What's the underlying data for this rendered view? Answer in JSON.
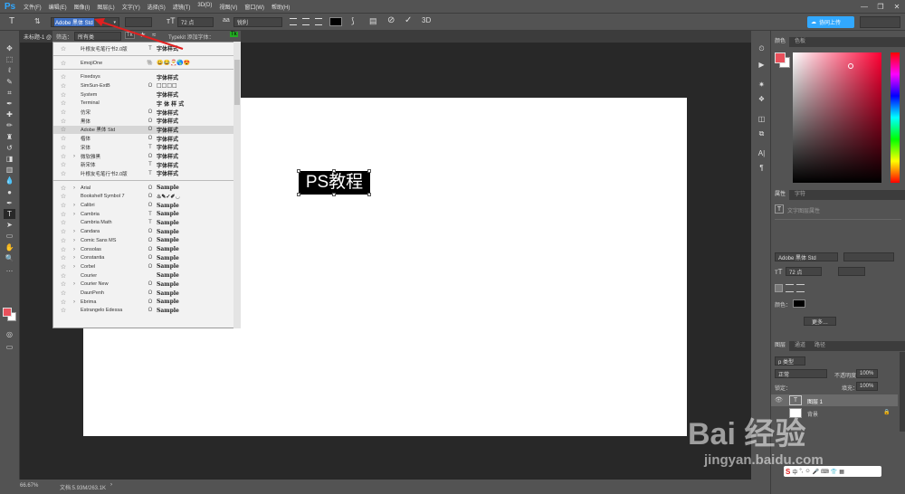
{
  "app": {
    "logo": "Ps",
    "share_button": "协同上传"
  },
  "menu": [
    "文件(F)",
    "编辑(E)",
    "图像(I)",
    "图层(L)",
    "文字(Y)",
    "选择(S)",
    "滤镜(T)",
    "3D(D)",
    "视图(V)",
    "窗口(W)",
    "帮助(H)"
  ],
  "window_controls": [
    "—",
    "❐",
    "✕"
  ],
  "options": {
    "font_family": "Adobe 黑体 Std",
    "font_size": "72 点",
    "antialias": "锐利",
    "commit_icons": [
      "cancel-icon",
      "commit-icon",
      "3d-icon"
    ]
  },
  "document_tab": "未标题-1 @",
  "font_filter": {
    "label": "筛选：",
    "value": "所有类",
    "typekit": "Typekit 添加字体："
  },
  "font_groups": [
    [
      {
        "name": "叶根友毛笔行书2.0版",
        "type": "T",
        "sample": "字体样式"
      }
    ],
    [
      {
        "name": "EmojiOne",
        "type": "🐘",
        "sample": "😀😂🎅🌎😍"
      }
    ],
    [
      {
        "name": "Fixedsys",
        "type": "",
        "sample": "字体样式"
      },
      {
        "name": "SimSun-ExtB",
        "type": "O",
        "sample": "□□□□"
      },
      {
        "name": "System",
        "type": "",
        "sample": "字体样式"
      },
      {
        "name": "Terminal",
        "type": "",
        "sample": "字 体 样 式"
      },
      {
        "name": "仿宋",
        "type": "O",
        "sample": "字体样式"
      },
      {
        "name": "黑体",
        "type": "O",
        "sample": "字体样式"
      },
      {
        "name": "Adobe 黑体 Std",
        "type": "O",
        "sample": "字体样式",
        "selected": true
      },
      {
        "name": "楷体",
        "type": "O",
        "sample": "字体样式"
      },
      {
        "name": "宋体",
        "type": "T",
        "sample": "字体样式"
      },
      {
        "name": "微软雅黑",
        "type": "O",
        "sample": "字体样式",
        "arrow": true
      },
      {
        "name": "新宋体",
        "type": "T",
        "sample": "字体样式"
      },
      {
        "name": "叶根友毛笔行书2.0版",
        "type": "T",
        "sample": "字体样式"
      }
    ],
    [
      {
        "name": "Arial",
        "type": "O",
        "sample": "Sample",
        "arrow": true
      },
      {
        "name": "Bookshelf Symbol 7",
        "type": "O",
        "sample": "♨✎✓✐◡"
      },
      {
        "name": "Calibri",
        "type": "O",
        "sample": "Sample",
        "arrow": true
      },
      {
        "name": "Cambria",
        "type": "T",
        "sample": "Sample",
        "arrow": true
      },
      {
        "name": "Cambria Math",
        "type": "T",
        "sample": "Sample"
      },
      {
        "name": "Candara",
        "type": "O",
        "sample": "Sample",
        "arrow": true
      },
      {
        "name": "Comic Sans MS",
        "type": "O",
        "sample": "Sample",
        "arrow": true
      },
      {
        "name": "Consolas",
        "type": "O",
        "sample": "Sample",
        "arrow": true
      },
      {
        "name": "Constantia",
        "type": "O",
        "sample": "Sample",
        "arrow": true
      },
      {
        "name": "Corbel",
        "type": "O",
        "sample": "Sample",
        "arrow": true
      },
      {
        "name": "Courier",
        "type": "",
        "sample": "Sample"
      },
      {
        "name": "Courier New",
        "type": "O",
        "sample": "Sample",
        "arrow": true
      },
      {
        "name": "DaunPenh",
        "type": "O",
        "sample": "Sample"
      },
      {
        "name": "Ebrima",
        "type": "O",
        "sample": "Sample",
        "arrow": true
      },
      {
        "name": "Estrangelo Edessa",
        "type": "O",
        "sample": "Sample"
      }
    ]
  ],
  "canvas_text": "PS教程",
  "status": {
    "zoom": "66.67%",
    "doc": "文档:5.93M/263.1K"
  },
  "panels": {
    "color_tabs": [
      "颜色",
      "色板"
    ],
    "props_tabs": [
      "属性",
      "字符"
    ],
    "props_title": "文字图层属性",
    "props_font": "Adobe 黑体 Std",
    "props_size": "72 点",
    "props_color_label": "颜色：",
    "props_more": "更多…",
    "layers_tabs": [
      "图层",
      "通道",
      "路径"
    ],
    "layer_kind": "p 类型",
    "blend_mode": "正常",
    "opacity_label": "不透明度：",
    "opacity": "100%",
    "lock_label": "锁定：",
    "fill_label": "填充：",
    "fill": "100%",
    "layers": [
      {
        "name": "图层 1"
      },
      {
        "name": "背景"
      }
    ]
  },
  "colors": {
    "foreground": "#e8505b",
    "accent": "#31a8ff",
    "arrow": "#e02020"
  },
  "watermark": {
    "brand": "Bai 经验",
    "url": "jingyan.baidu.com"
  }
}
